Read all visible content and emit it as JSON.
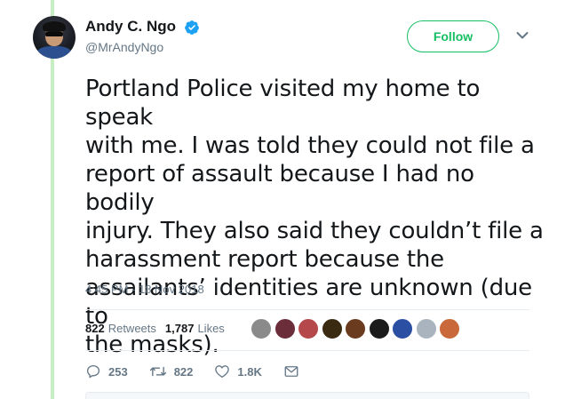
{
  "user": {
    "name": "Andy C. Ngo",
    "handle": "@MrAndyNgo",
    "verified": true
  },
  "follow_button": {
    "label": "Follow"
  },
  "tweet": {
    "lines": [
      "Portland Police visited my home to speak",
      "with me. I was told they could not file a",
      "report of assault because I had no bodily",
      "injury. They also said they couldn’t file a",
      "harassment report because the",
      "assailants’ identities are unknown (due to",
      "the masks)."
    ],
    "timestamp": "4:45 PM - 18 Nov 2018"
  },
  "stats": {
    "retweets_count": "822",
    "retweets_label": "Retweets",
    "likes_count": "1,787",
    "likes_label": "Likes"
  },
  "liker_avatars": [
    "#8a8a8a",
    "#6b2d3a",
    "#b5484a",
    "#3b2a12",
    "#6a3b1e",
    "#1b1b1b",
    "#2b4fa3",
    "#a9b4bf",
    "#c9683a"
  ],
  "actions": {
    "reply_count": "253",
    "retweet_count": "822",
    "like_count": "1.8K"
  },
  "colors": {
    "accent_green": "#17bf63",
    "verified_blue": "#1da1f2",
    "thread_line": "#c7edc2",
    "secondary_text": "#657786"
  },
  "icons": [
    "verified-badge-icon",
    "chevron-down-icon",
    "reply-icon",
    "retweet-icon",
    "heart-icon",
    "envelope-icon"
  ]
}
